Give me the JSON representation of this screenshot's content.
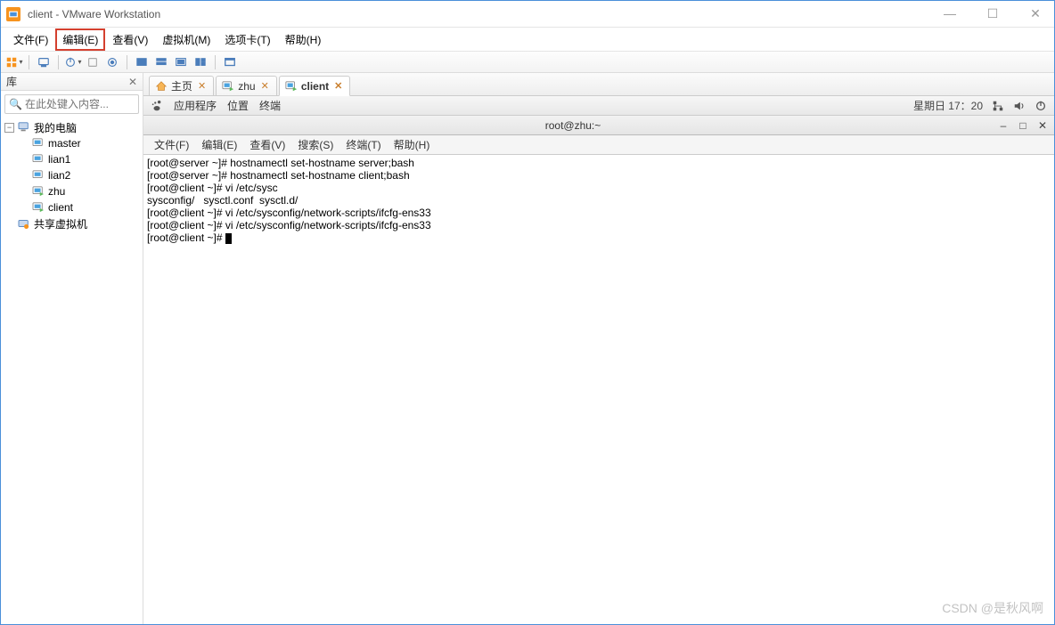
{
  "titlebar": {
    "title": "client - VMware Workstation"
  },
  "menubar": {
    "file": "文件(F)",
    "edit": "编辑(E)",
    "view": "查看(V)",
    "vm": "虚拟机(M)",
    "tabs": "选项卡(T)",
    "help": "帮助(H)"
  },
  "sidebar": {
    "header": "库",
    "search_placeholder": "在此处键入内容...",
    "root": "我的电脑",
    "items": [
      "master",
      "lian1",
      "lian2",
      "zhu",
      "client"
    ],
    "shared": "共享虚拟机"
  },
  "tabs": [
    {
      "label": "主页",
      "active": false,
      "icon": "home"
    },
    {
      "label": "zhu",
      "active": false,
      "icon": "vm"
    },
    {
      "label": "client",
      "active": true,
      "icon": "vm"
    }
  ],
  "gnome": {
    "apps": "应用程序",
    "places": "位置",
    "terminal": "终端",
    "clock": "星期日 17：20"
  },
  "terminal": {
    "title": "root@zhu:~",
    "menus": {
      "file": "文件(F)",
      "edit": "编辑(E)",
      "view": "查看(V)",
      "search": "搜索(S)",
      "terminal": "终端(T)",
      "help": "帮助(H)"
    },
    "lines": [
      "[root@server ~]# hostnamectl set-hostname server;bash",
      "[root@server ~]# hostnamectl set-hostname client;bash",
      "[root@client ~]# vi /etc/sysc",
      "sysconfig/   sysctl.conf  sysctl.d/",
      "[root@client ~]# vi /etc/sysconfig/network-scripts/ifcfg-ens33",
      "[root@client ~]# vi /etc/sysconfig/network-scripts/ifcfg-ens33",
      "[root@client ~]# "
    ]
  },
  "watermark": "CSDN @是秋风啊"
}
